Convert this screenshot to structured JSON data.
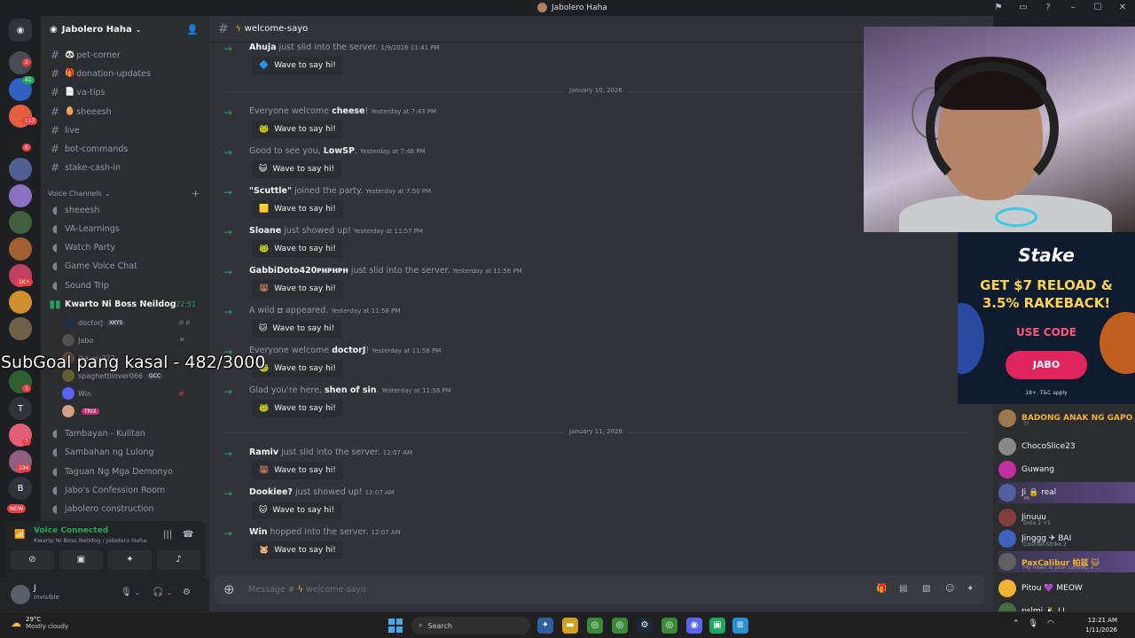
{
  "window": {
    "title": "Jabolero Haha"
  },
  "server": {
    "name": "Jabolero Haha"
  },
  "rail": {
    "badges": [
      "2",
      "41",
      "113",
      "6",
      "1K+",
      "1",
      "7",
      "194"
    ],
    "letter_t": "T",
    "letter_b": "B",
    "new_label": "NEW"
  },
  "channels": [
    {
      "emoji": "🐼",
      "label": "pet-corner"
    },
    {
      "emoji": "🎁",
      "label": "donation-updates"
    },
    {
      "emoji": "📄",
      "label": "va-tips"
    },
    {
      "emoji": "🥚",
      "label": "sheeesh"
    },
    {
      "emoji": "",
      "label": "live"
    },
    {
      "emoji": "",
      "label": "bot-commands"
    },
    {
      "emoji": "",
      "label": "stake-cash-in"
    }
  ],
  "voice_category": "Voice Channels",
  "voice_channels": [
    {
      "label": "sheeesh"
    },
    {
      "label": "VA-Learnings"
    },
    {
      "label": "Watch Party"
    },
    {
      "label": "Game Voice Chat"
    },
    {
      "label": "Sound Trip"
    }
  ],
  "active_voice": {
    "label": "Kwarto Ni Boss Neildog",
    "time": "22:51"
  },
  "voice_users": [
    {
      "name": "doctorJ",
      "badge": "XKYS"
    },
    {
      "name": "Jabo",
      "badge": ""
    },
    {
      "name": "jhayyy322",
      "badge": ""
    },
    {
      "name": "spaghettilover066",
      "badge": "GCC"
    },
    {
      "name": "Win",
      "badge": ""
    },
    {
      "name": "",
      "badge": "TRIX"
    }
  ],
  "more_voice_channels": [
    {
      "label": "Tambayan - Kulitan"
    },
    {
      "label": "Sambahan ng Lulong"
    },
    {
      "label": "Taguan Ng Mga Demonyo"
    },
    {
      "label": "Jabo's Confession Room"
    },
    {
      "label": "jabolero construction"
    }
  ],
  "voice_panel": {
    "status": "Voice Connected",
    "location": "Kwarto Ni Boss Neildog / Jabolero Haha"
  },
  "user_panel": {
    "name": "J",
    "status": "Invisible"
  },
  "channel_header": {
    "name": "welcome-sayo"
  },
  "wave_label": "Wave to say hi!",
  "messages": [
    {
      "pre": "",
      "name": "Ahuja",
      "post": " just slid into the server.",
      "ts": "1/9/2026 11:41 PM",
      "sticker": "🔷"
    },
    {
      "pre": "Everyone welcome ",
      "name": "cheese",
      "post": "!",
      "ts": "Yesterday at 7:43 PM",
      "sticker": "🐸"
    },
    {
      "pre": "Good to see you, ",
      "name": "LowSP",
      "post": ".",
      "ts": "Yesterday at 7:46 PM",
      "sticker": "😺"
    },
    {
      "pre": "",
      "name": "\"Scuttle\"",
      "post": " joined the party.",
      "ts": "Yesterday at 7:50 PM",
      "sticker": "🟨"
    },
    {
      "pre": "",
      "name": "Sloane",
      "post": " just showed up!",
      "ts": "Yesterday at 11:57 PM",
      "sticker": "🐸"
    },
    {
      "pre": "",
      "name": "GabbiDoto420ᴘʜᴘʜᴘʜ",
      "post": " just slid into the server.",
      "ts": "Yesterday at 11:58 PM",
      "sticker": "🐻"
    },
    {
      "pre": "A wild ",
      "name": "▫",
      "post": " appeared.",
      "ts": "Yesterday at 11:58 PM",
      "sticker": "🐱"
    },
    {
      "pre": "Everyone welcome ",
      "name": "doctorJ",
      "post": "!",
      "ts": "Yesterday at 11:58 PM",
      "sticker": "🐸"
    },
    {
      "pre": "Glad you're here, ",
      "name": "shen of sin",
      "post": ".",
      "ts": "Yesterday at 11:58 PM",
      "sticker": "🐸"
    },
    {
      "pre": "",
      "name": "Ramiv",
      "post": " just slid into the server.",
      "ts": "12:07 AM",
      "sticker": "🐻"
    },
    {
      "pre": "",
      "name": "Dookiee?",
      "post": " just showed up!",
      "ts": "12:07 AM",
      "sticker": "🐱"
    },
    {
      "pre": "",
      "name": "Win",
      "post": " hopped into the server.",
      "ts": "12:07 AM",
      "sticker": "🐹"
    }
  ],
  "dates": [
    "January 10, 2026",
    "January 11, 2026"
  ],
  "composer": {
    "placeholder_prefix": "Message # ",
    "channel": "welcome-sayo"
  },
  "overlay": {
    "text": "SubGoal pang kasal - 482/3000"
  },
  "stake_ad": {
    "logo": "Stake",
    "line1": "GET $7 RELOAD &",
    "line2": "3.5% RAKEBACK!",
    "use_code": "USE CODE",
    "code": "JABO",
    "terms": "18+. T&C apply"
  },
  "members": [
    {
      "name": "BADONG ANAK NG GAPO",
      "sub": "??",
      "style": "gold",
      "color": "#a07850"
    },
    {
      "name": "ChocoSlice23",
      "sub": "",
      "style": "",
      "color": "#888"
    },
    {
      "name": "Guwang",
      "sub": "",
      "style": "",
      "color": "#c030a0"
    },
    {
      "name": "Ji 🔒 real",
      "sub": "🎮",
      "style": "hl",
      "color": "#5060a0"
    },
    {
      "name": "Jinuuu",
      "sub": "Dota 2 +1",
      "style": "",
      "color": "#804040"
    },
    {
      "name": "Jinggg ✈ BAI",
      "sub": "Counter-Strike 2",
      "style": "",
      "color": "#4060c0"
    },
    {
      "name": "PaxCalibur 帕兹 😺",
      "sub": "My heart is your canvas, a...",
      "style": "gold hl",
      "color": "#606060"
    },
    {
      "name": "Pitou 💜 MEOW",
      "sub": "",
      "style": "",
      "color": "#f0b232"
    },
    {
      "name": "pslmi 🐧 LI",
      "sub": "",
      "style": "",
      "color": "#407040"
    }
  ],
  "taskbar": {
    "temp": "29°C",
    "weather": "Mostly cloudy",
    "search": "Search",
    "time": "12:21 AM",
    "date": "1/11/2026"
  },
  "colors": {
    "accent_green": "#23a55a",
    "bg_main": "#313338",
    "bg_sidebar": "#2b2d31",
    "rail": "#1e1f22"
  }
}
